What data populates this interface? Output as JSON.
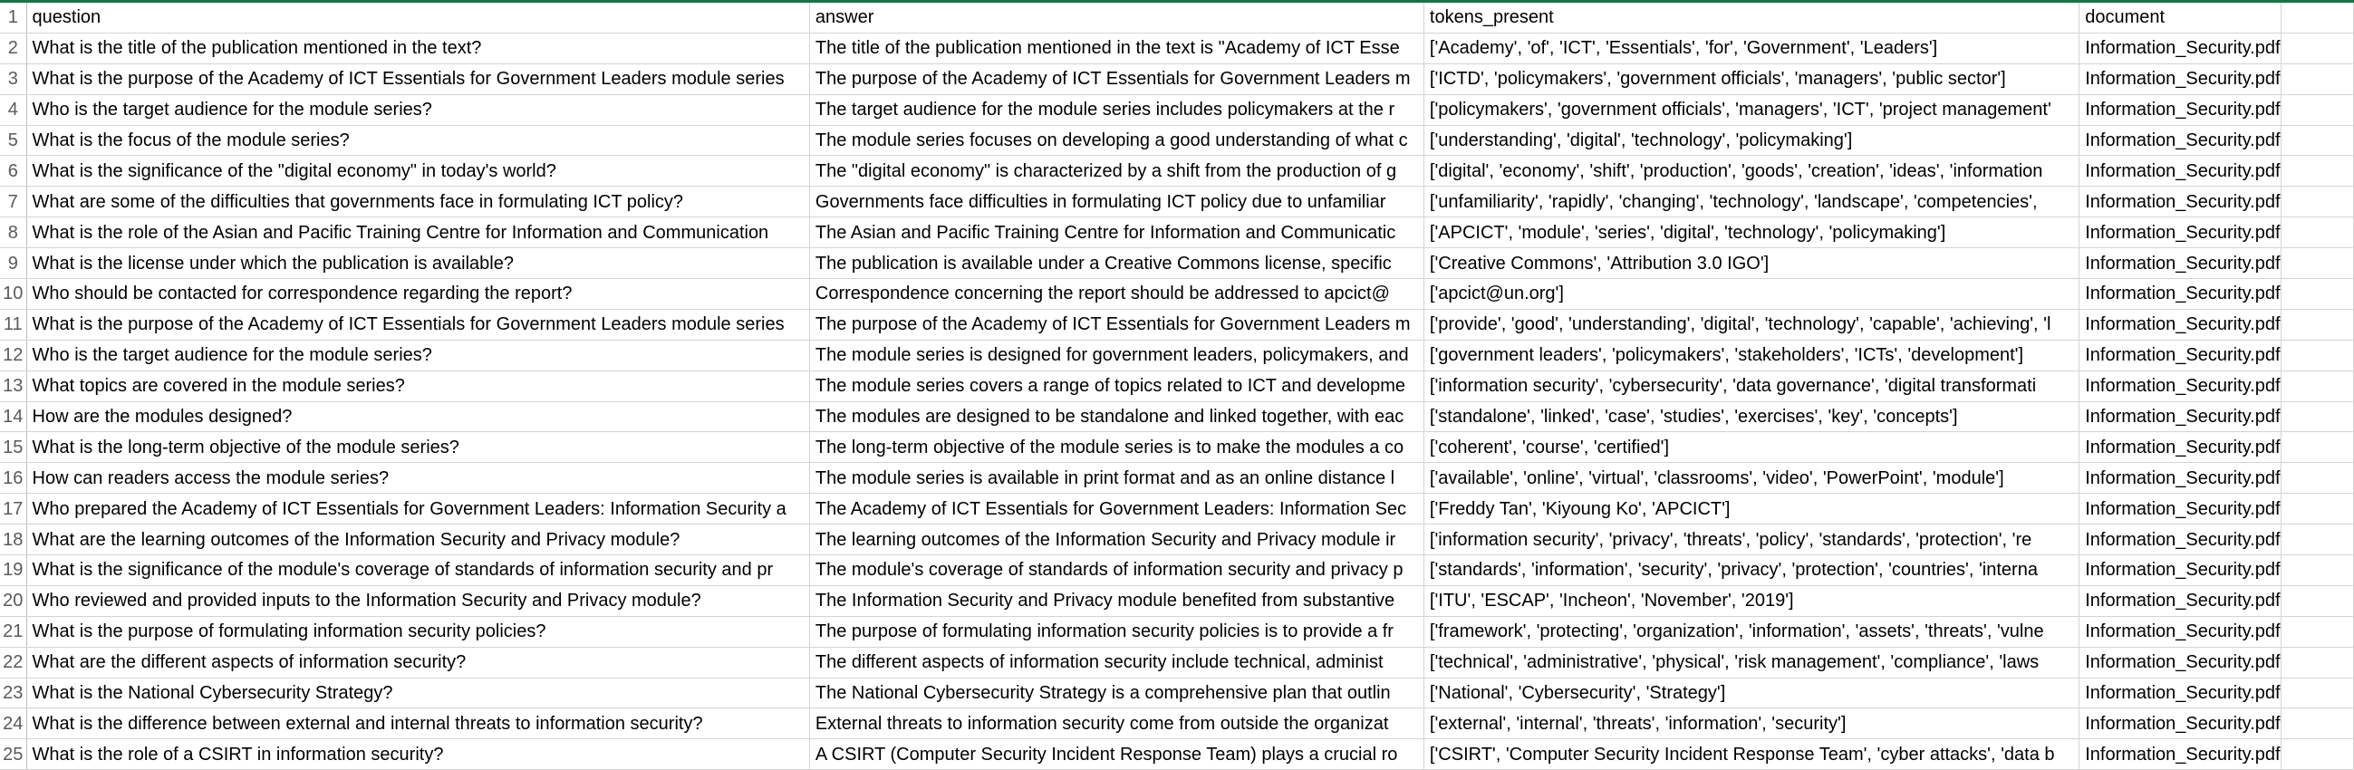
{
  "sheet": {
    "rows": [
      {
        "num": "1",
        "question": "question",
        "answer": "answer",
        "tokens_present": "tokens_present",
        "document": "document"
      },
      {
        "num": "2",
        "question": "What is the title of the publication mentioned in the text?",
        "answer": "The title of the publication mentioned in the text is \"Academy of ICT Esse",
        "tokens_present": "['Academy', 'of', 'ICT', 'Essentials', 'for', 'Government', 'Leaders']",
        "document": "Information_Security.pdf"
      },
      {
        "num": "3",
        "question": "What is the purpose of the Academy of ICT Essentials for Government Leaders module series",
        "answer": "The purpose of the Academy of ICT Essentials for Government Leaders m",
        "tokens_present": "['ICTD', 'policymakers', 'government officials', 'managers', 'public sector']",
        "document": "Information_Security.pdf"
      },
      {
        "num": "4",
        "question": "Who is the target audience for the module series?",
        "answer": "The target audience for the module series includes policymakers at the r",
        "tokens_present": "['policymakers', 'government officials', 'managers', 'ICT', 'project management'",
        "document": "Information_Security.pdf"
      },
      {
        "num": "5",
        "question": "What is the focus of the module series?",
        "answer": "The module series focuses on developing a good understanding of what c",
        "tokens_present": "['understanding', 'digital', 'technology', 'policymaking']",
        "document": "Information_Security.pdf"
      },
      {
        "num": "6",
        "question": "What is the significance of the \"digital economy\" in today's world?",
        "answer": "The \"digital economy\" is characterized by a shift from the production of g",
        "tokens_present": "['digital', 'economy', 'shift', 'production', 'goods', 'creation', 'ideas', 'information",
        "document": "Information_Security.pdf"
      },
      {
        "num": "7",
        "question": "What are some of the difficulties that governments face in formulating ICT policy?",
        "answer": "Governments face difficulties in formulating ICT policy due to unfamiliar",
        "tokens_present": "['unfamiliarity', 'rapidly', 'changing', 'technology', 'landscape', 'competencies',",
        "document": "Information_Security.pdf"
      },
      {
        "num": "8",
        "question": "What is the role of the Asian and Pacific Training Centre for Information and Communication",
        "answer": "The Asian and Pacific Training Centre for Information and Communicatic",
        "tokens_present": "['APCICT', 'module', 'series', 'digital', 'technology', 'policymaking']",
        "document": "Information_Security.pdf"
      },
      {
        "num": "9",
        "question": "What is the license under which the publication is available?",
        "answer": "The publication is available under a Creative Commons license, specific",
        "tokens_present": "['Creative Commons', 'Attribution 3.0 IGO']",
        "document": "Information_Security.pdf"
      },
      {
        "num": "10",
        "question": "Who should be contacted for correspondence regarding the report?",
        "answer": "Correspondence concerning the report should be addressed to apcict@",
        "tokens_present": "['apcict@un.org']",
        "document": "Information_Security.pdf"
      },
      {
        "num": "11",
        "question": "What is the purpose of the Academy of ICT Essentials for Government Leaders module series",
        "answer": "The purpose of the Academy of ICT Essentials for Government Leaders m",
        "tokens_present": "['provide', 'good', 'understanding', 'digital', 'technology', 'capable', 'achieving', 'l",
        "document": "Information_Security.pdf"
      },
      {
        "num": "12",
        "question": "Who is the target audience for the module series?",
        "answer": "The module series is designed for government leaders, policymakers, and",
        "tokens_present": "['government leaders', 'policymakers', 'stakeholders', 'ICTs', 'development']",
        "document": "Information_Security.pdf"
      },
      {
        "num": "13",
        "question": "What topics are covered in the module series?",
        "answer": "The module series covers a range of topics related to ICT and developme",
        "tokens_present": "['information security', 'cybersecurity', 'data governance', 'digital transformati",
        "document": "Information_Security.pdf"
      },
      {
        "num": "14",
        "question": "How are the modules designed?",
        "answer": "The modules are designed to be standalone and linked together, with eac",
        "tokens_present": "['standalone', 'linked', 'case', 'studies', 'exercises', 'key', 'concepts']",
        "document": "Information_Security.pdf"
      },
      {
        "num": "15",
        "question": "What is the long-term objective of the module series?",
        "answer": "The long-term objective of the module series is to make the modules a co",
        "tokens_present": "['coherent', 'course', 'certified']",
        "document": "Information_Security.pdf"
      },
      {
        "num": "16",
        "question": "How can readers access the module series?",
        "answer": "The module series is available in print format and as an online distance l",
        "tokens_present": "['available', 'online', 'virtual', 'classrooms', 'video', 'PowerPoint', 'module']",
        "document": "Information_Security.pdf"
      },
      {
        "num": "17",
        "question": "Who prepared the Academy of ICT Essentials for Government Leaders: Information Security a",
        "answer": "The Academy of ICT Essentials for Government Leaders: Information Sec",
        "tokens_present": "['Freddy Tan', 'Kiyoung Ko', 'APCICT']",
        "document": "Information_Security.pdf"
      },
      {
        "num": "18",
        "question": "What are the learning outcomes of the Information Security and Privacy module?",
        "answer": "The learning outcomes of the Information Security and Privacy module ir",
        "tokens_present": "['information security', 'privacy', 'threats', 'policy', 'standards', 'protection', 're",
        "document": "Information_Security.pdf"
      },
      {
        "num": "19",
        "question": "What is the significance of the module's coverage of standards of information security and pr",
        "answer": "The module's coverage of standards of information security and privacy p",
        "tokens_present": "['standards', 'information', 'security', 'privacy', 'protection', 'countries', 'interna",
        "document": "Information_Security.pdf"
      },
      {
        "num": "20",
        "question": "Who reviewed and provided inputs to the Information Security and Privacy module?",
        "answer": "The Information Security and Privacy module benefited from substantive",
        "tokens_present": "['ITU', 'ESCAP', 'Incheon', 'November', '2019']",
        "document": "Information_Security.pdf"
      },
      {
        "num": "21",
        "question": "What is the purpose of formulating information security policies?",
        "answer": "The purpose of formulating information security policies is to provide a fr",
        "tokens_present": "['framework', 'protecting', 'organization', 'information', 'assets', 'threats', 'vulne",
        "document": "Information_Security.pdf"
      },
      {
        "num": "22",
        "question": "What are the different aspects of information security?",
        "answer": "The different aspects of information security include technical, administ",
        "tokens_present": "['technical', 'administrative', 'physical', 'risk management', 'compliance', 'laws",
        "document": "Information_Security.pdf"
      },
      {
        "num": "23",
        "question": "What is the National Cybersecurity Strategy?",
        "answer": "The National Cybersecurity Strategy is a comprehensive plan that outlin",
        "tokens_present": "['National', 'Cybersecurity', 'Strategy']",
        "document": "Information_Security.pdf"
      },
      {
        "num": "24",
        "question": "What is the difference between external and internal threats to information security?",
        "answer": "External threats to information security come from outside the organizat",
        "tokens_present": "['external', 'internal', 'threats', 'information', 'security']",
        "document": "Information_Security.pdf"
      },
      {
        "num": "25",
        "question": "What is the role of a CSIRT in information security?",
        "answer": "A CSIRT (Computer Security Incident Response Team) plays a crucial ro",
        "tokens_present": "['CSIRT', 'Computer Security Incident Response Team', 'cyber attacks', 'data b",
        "document": "Information_Security.pdf"
      }
    ]
  }
}
